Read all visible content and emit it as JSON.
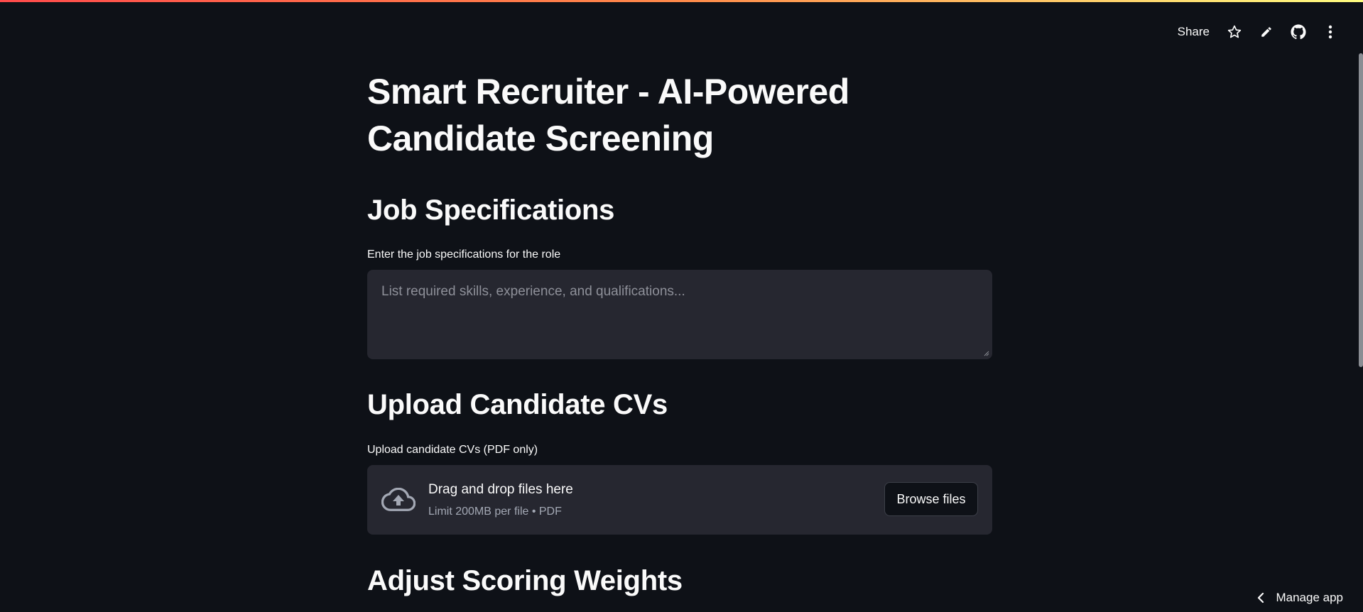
{
  "toolbar": {
    "share_label": "Share",
    "icons": [
      "star-icon",
      "pencil-icon",
      "github-icon",
      "more-vertical-icon"
    ]
  },
  "page": {
    "title": "Smart Recruiter - AI-Powered Candidate Screening"
  },
  "job_specs": {
    "header": "Job Specifications",
    "label": "Enter the job specifications for the role",
    "placeholder": "List required skills, experience, and qualifications..."
  },
  "upload": {
    "header": "Upload Candidate CVs",
    "label": "Upload candidate CVs (PDF only)",
    "drop_text": "Drag and drop files here",
    "limit_text": "Limit 200MB per file • PDF",
    "browse_label": "Browse files"
  },
  "scoring": {
    "header": "Adjust Scoring Weights"
  },
  "footer": {
    "manage_label": "Manage app"
  },
  "colors": {
    "background": "#0e1117",
    "surface": "#262730",
    "text": "#fafafa",
    "muted": "#a3a8b4",
    "accent_gradient": [
      "#ff4b4b",
      "#fffd80"
    ]
  }
}
